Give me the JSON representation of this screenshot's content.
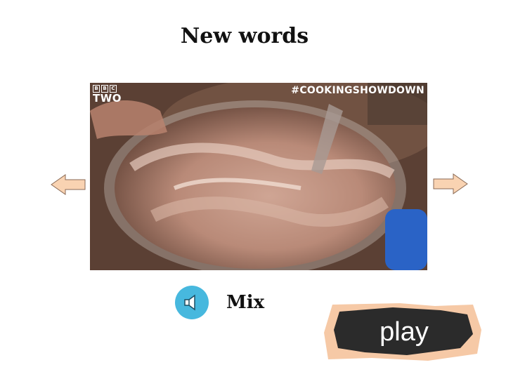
{
  "slide": {
    "title": "New words",
    "word": "Mix",
    "play_label": "play"
  },
  "video": {
    "channel_brand": "BBC",
    "channel_name": "TWO",
    "hashtag": "#COOKINGSHOWDOWN"
  },
  "icons": {
    "prev": "arrow-left-icon",
    "next": "arrow-right-icon",
    "audio": "speaker-icon"
  },
  "colors": {
    "arrow_fill": "#f9d3b2",
    "speaker_bg": "#47b8de",
    "play_bg": "#2b2b2b",
    "play_border": "#f6c9a6"
  }
}
